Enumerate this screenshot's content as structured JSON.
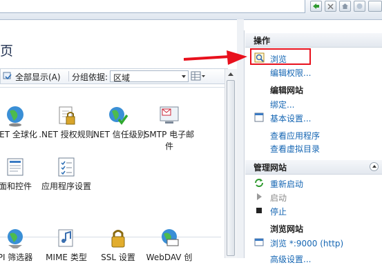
{
  "title": "页",
  "toolbar": {
    "show_all": "全部显示(A)",
    "group_by": "分组依据:",
    "group_value": "区域"
  },
  "features": [
    {
      "label": "NET 全球化",
      "icon": "globe-icon"
    },
    {
      "label": ".NET 授权规则",
      "icon": "lock-doc-icon"
    },
    {
      "label": ".NET 信任级别",
      "icon": "globe-check-icon"
    },
    {
      "label": "SMTP 电子邮件",
      "icon": "mail-screen-icon"
    },
    {
      "label": "面和控件",
      "icon": "page-controls-icon"
    },
    {
      "label": "应用程序设置",
      "icon": "checklist-icon"
    },
    {
      "label": "PI 筛选器",
      "icon": "filter-icon"
    },
    {
      "label": "MIME 类型",
      "icon": "media-icon"
    },
    {
      "label": "SSL 设置",
      "icon": "padlock-icon"
    },
    {
      "label": "WebDAV 创",
      "icon": "webdav-globe-icon"
    }
  ],
  "actions": {
    "header": "操作",
    "browse": "浏览",
    "edit_permissions": "编辑权限...",
    "edit_site_group": "编辑网站",
    "bindings": "绑定...",
    "basic_settings": "基本设置...",
    "view_apps": "查看应用程序",
    "view_vdirs": "查看虚拟目录",
    "manage_site_header": "管理网站",
    "restart": "重新启动",
    "start": "启动",
    "stop": "停止",
    "browse_site_group": "浏览网站",
    "browse_port": "浏览 *:9000 (http)",
    "advanced_settings": "高级设置..."
  },
  "colors": {
    "link": "#1566b3",
    "highlight": "#e8101c",
    "arrow": "#e8101c"
  }
}
